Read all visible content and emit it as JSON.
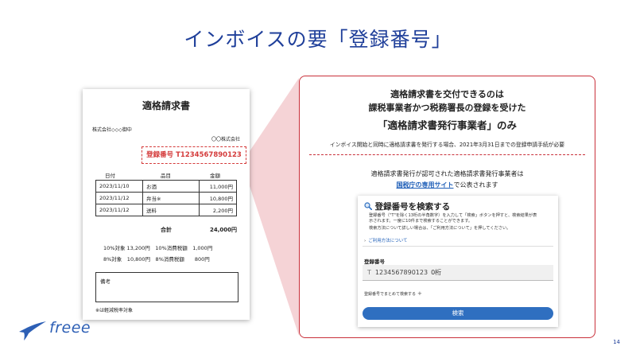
{
  "slide": {
    "title": "インボイスの要「登録番号」",
    "page_number": "14",
    "logo_text": "freee"
  },
  "invoice": {
    "title": "適格請求書",
    "addressee": "株式会社◇◇◇御中",
    "issuer": "〇〇株式会社",
    "registration_number": "登録番号 T1234567890123",
    "columns": [
      "日付",
      "品目",
      "金額"
    ],
    "rows": [
      [
        "2023/11/10",
        "お酒",
        "11,000円"
      ],
      [
        "2023/11/12",
        "弁当※",
        "10,800円"
      ],
      [
        "2023/11/12",
        "送料",
        "2,200円"
      ]
    ],
    "total_label": "合計",
    "total_value": "24,000円",
    "tax_rows": [
      "10%対象 13,200円　10%消費税額　1,000円",
      "8%対象　10,800円　8%消費税額　　800円"
    ],
    "notes_label": "備考",
    "footnote": "※は軽減税率対象"
  },
  "callout": {
    "heading_1": "適格請求書を交付できるのは",
    "heading_2": "課税事業者かつ税務署長の登録を受けた",
    "heading_3": "「適格請求書発行事業者」のみ",
    "note": "インボイス開始と同時に適格請求書を発行する場合、2021年3月31日までの登録申請手続が必要",
    "approved": "適格請求書発行が認可された適格請求書発行事業者は",
    "link_text": "国税庁の専用サイト",
    "link_suffix": "で公表されます"
  },
  "search_panel": {
    "title": "登録番号を検索する",
    "desc_1": "登録番号（\"T\"を除く13桁の半角数字）を入力して「検索」ボタンを押すと、検索結果が表",
    "desc_2": "示されます。一度に10件まで検索することができます。",
    "desc_3": "検索方法について詳しい場合は、「ご利用方法について」を押してください。",
    "help_link": "ご利用方法について",
    "field_label": "登録番号",
    "input_prefix": "T",
    "input_value": "1234567890123",
    "digit_count": "0桁",
    "bulk_search": "登録番号でまとめて検索する",
    "search_button": "検索"
  }
}
